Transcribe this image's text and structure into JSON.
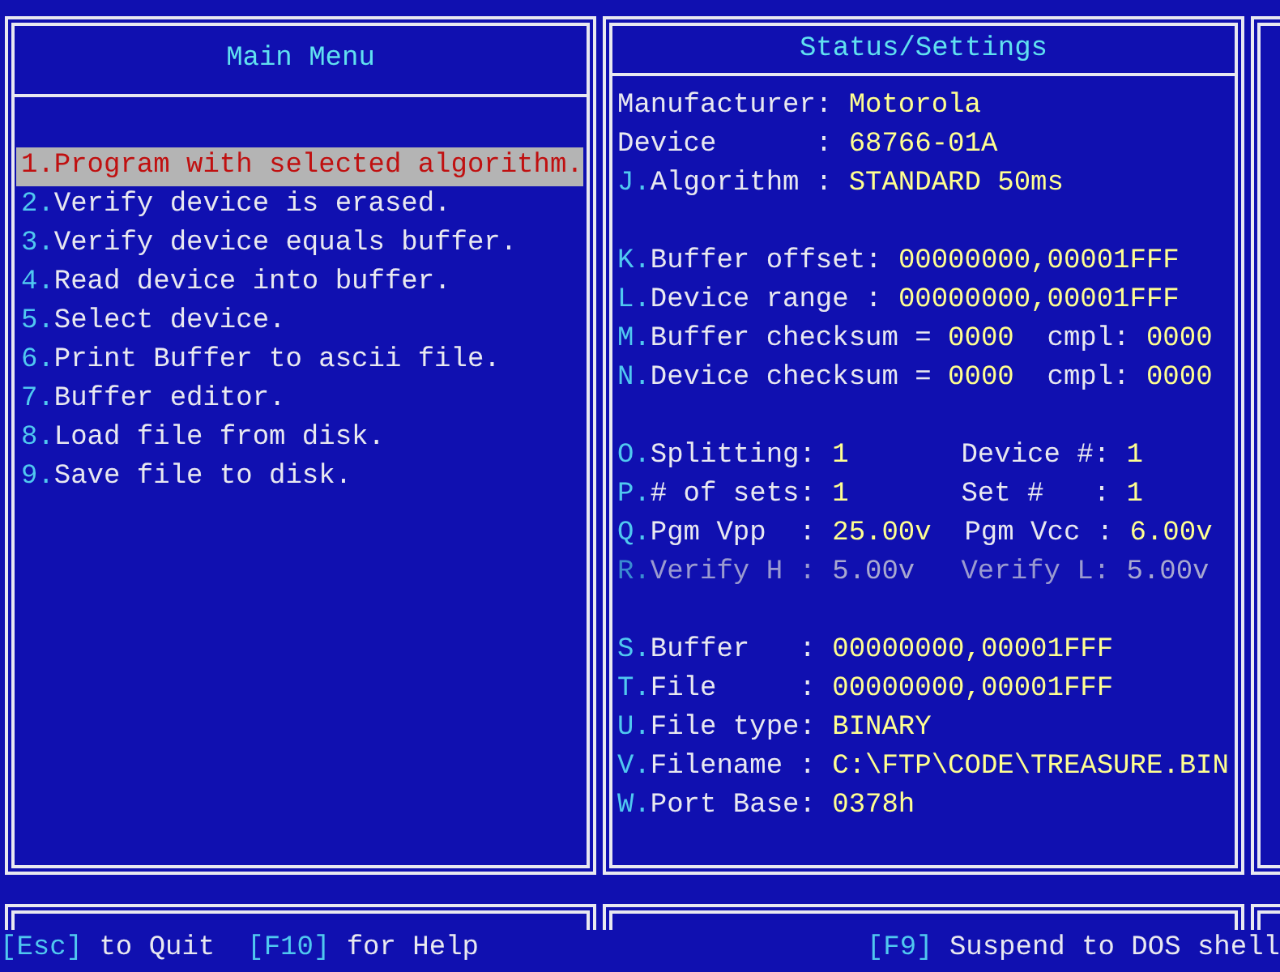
{
  "left_panel": {
    "title": "Main Menu",
    "items": [
      {
        "key": "1.",
        "label": "Program with selected algorithm.",
        "selected": true
      },
      {
        "key": "2.",
        "label": "Verify device is erased.",
        "selected": false
      },
      {
        "key": "3.",
        "label": "Verify device equals buffer.",
        "selected": false
      },
      {
        "key": "4.",
        "label": "Read device into buffer.",
        "selected": false
      },
      {
        "key": "5.",
        "label": "Select device.",
        "selected": false
      },
      {
        "key": "6.",
        "label": "Print Buffer to ascii file.",
        "selected": false
      },
      {
        "key": "7.",
        "label": "Buffer editor.",
        "selected": false
      },
      {
        "key": "8.",
        "label": "Load file from disk.",
        "selected": false
      },
      {
        "key": "9.",
        "label": "Save file to disk.",
        "selected": false
      }
    ]
  },
  "right_panel": {
    "title": "Status/Settings",
    "groups": [
      {
        "lines": [
          {
            "disabled": false,
            "fields": [
              {
                "label": "Manufacturer:",
                "value": "Motorola"
              }
            ]
          },
          {
            "disabled": false,
            "fields": [
              {
                "label": "Device      :",
                "value": "68766-01A"
              }
            ]
          },
          {
            "disabled": false,
            "fields": [
              {
                "key": "J.",
                "label": "Algorithm :",
                "value": "STANDARD 50ms"
              }
            ]
          }
        ]
      },
      {
        "lines": [
          {
            "disabled": false,
            "fields": [
              {
                "key": "K.",
                "label": "Buffer offset:",
                "value": "00000000,00001FFF"
              }
            ]
          },
          {
            "disabled": false,
            "fields": [
              {
                "key": "L.",
                "label": "Device range :",
                "value": "00000000,00001FFF"
              }
            ]
          },
          {
            "disabled": false,
            "fields": [
              {
                "key": "M.",
                "label": "Buffer checksum =",
                "value": "0000"
              },
              {
                "label": "cmpl:",
                "value": "0000"
              }
            ]
          },
          {
            "disabled": false,
            "fields": [
              {
                "key": "N.",
                "label": "Device checksum =",
                "value": "0000"
              },
              {
                "label": "cmpl:",
                "value": "0000"
              }
            ]
          }
        ]
      },
      {
        "lines": [
          {
            "disabled": false,
            "fields": [
              {
                "key": "O.",
                "label": "Splitting:",
                "value": "1"
              },
              {
                "label": "Device #:",
                "value": "1"
              }
            ]
          },
          {
            "disabled": false,
            "fields": [
              {
                "key": "P.",
                "label": "# of sets:",
                "value": "1"
              },
              {
                "label": "Set #   :",
                "value": "1"
              }
            ]
          },
          {
            "disabled": false,
            "fields": [
              {
                "key": "Q.",
                "label": "Pgm Vpp  :",
                "value": "25.00v"
              },
              {
                "label": "Pgm Vcc :",
                "value": "6.00v"
              }
            ]
          },
          {
            "disabled": true,
            "fields": [
              {
                "key": "R.",
                "label": "Verify H :",
                "value": "5.00v"
              },
              {
                "label": "Verify L:",
                "value": "5.00v"
              }
            ]
          }
        ]
      },
      {
        "lines": [
          {
            "disabled": false,
            "fields": [
              {
                "key": "S.",
                "label": "Buffer   :",
                "value": "00000000,00001FFF"
              }
            ]
          },
          {
            "disabled": false,
            "fields": [
              {
                "key": "T.",
                "label": "File     :",
                "value": "00000000,00001FFF"
              }
            ]
          },
          {
            "disabled": false,
            "fields": [
              {
                "key": "U.",
                "label": "File type:",
                "value": "BINARY"
              }
            ]
          },
          {
            "disabled": false,
            "fields": [
              {
                "key": "V.",
                "label": "Filename :",
                "value": "C:\\FTP\\CODE\\TREASURE.BIN"
              }
            ]
          },
          {
            "disabled": false,
            "fields": [
              {
                "key": "W.",
                "label": "Port Base:",
                "value": "0378h"
              }
            ]
          }
        ]
      }
    ]
  },
  "status_bar": {
    "left": [
      {
        "key": "[Esc]",
        "label": "to Quit"
      },
      {
        "key": "[F10]",
        "label": "for Help"
      }
    ],
    "right": [
      {
        "key": "[F9]",
        "label": "Suspend to DOS shell"
      }
    ]
  }
}
